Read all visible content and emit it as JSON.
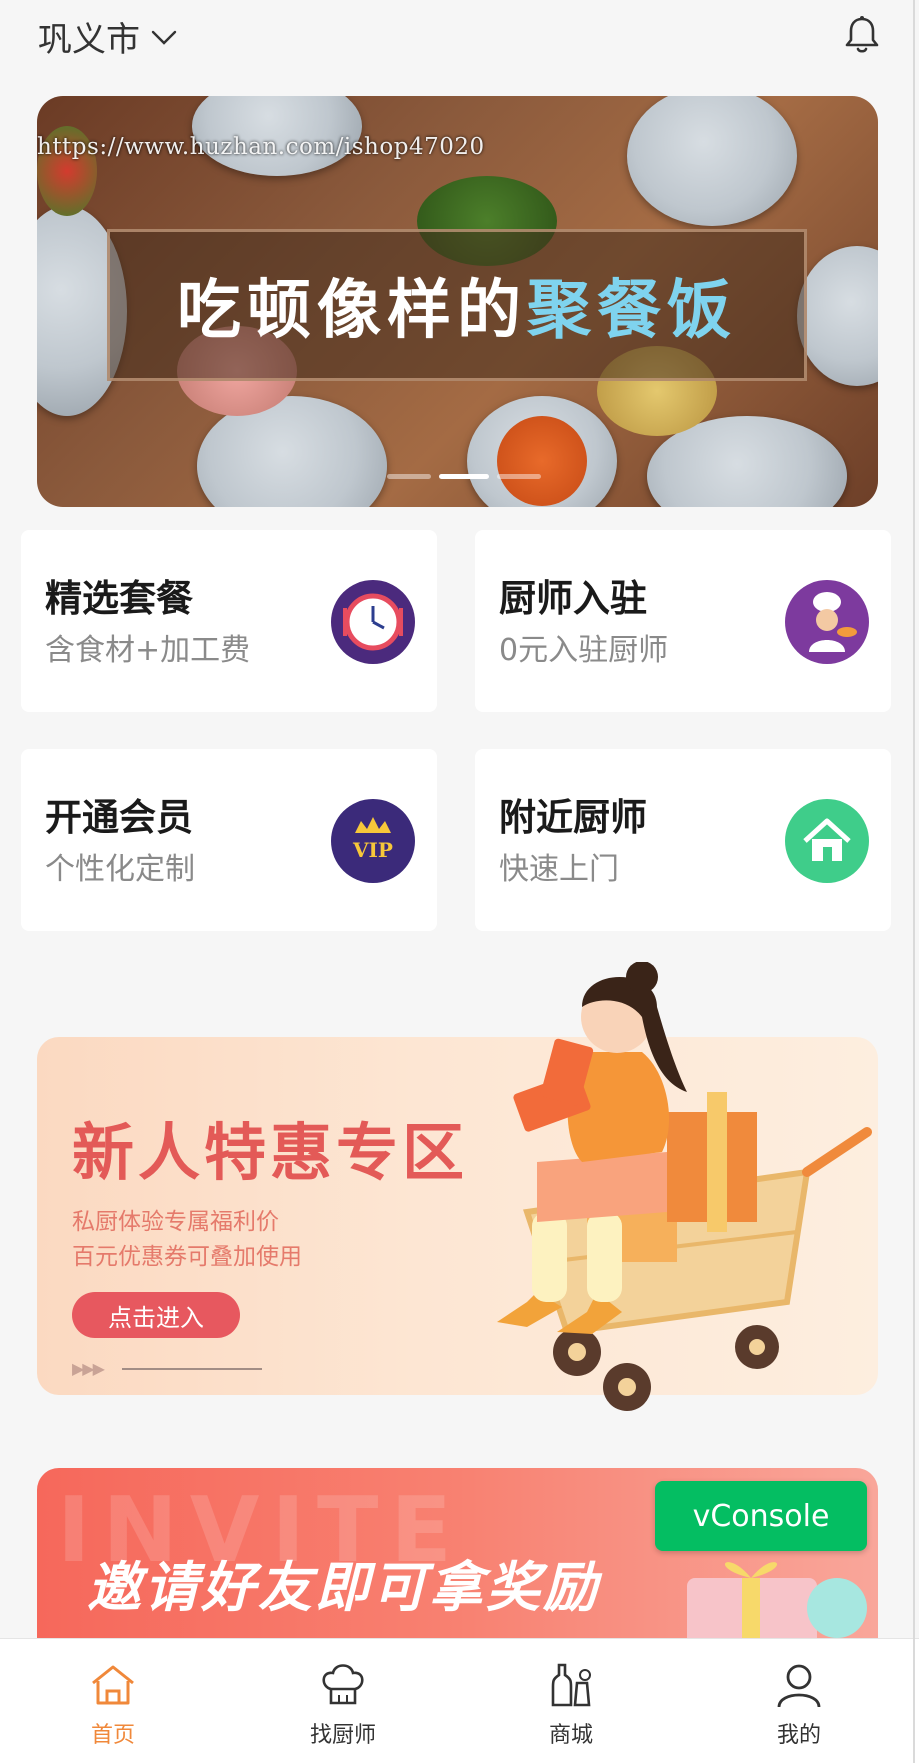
{
  "header": {
    "city": "巩义市",
    "chevron_icon": "chevron-down-icon",
    "bell_icon": "bell-icon"
  },
  "banner": {
    "watermark": "https://www.huzhan.com/ishop47020",
    "headline_main": "吃顿像样的",
    "headline_highlight": "聚餐饭",
    "highlight_color": "#7fd3ee",
    "slide_count": 3,
    "active_slide": 2
  },
  "cards": [
    {
      "title": "精选套餐",
      "subtitle": "含食材+加工费",
      "icon": "clock-cutlery-icon",
      "icon_color": "#4b2a7d"
    },
    {
      "title": "厨师入驻",
      "subtitle": "0元入驻厨师",
      "icon": "chef-icon",
      "icon_color": "#7d3a9e"
    },
    {
      "title": "开通会员",
      "subtitle": "个性化定制",
      "icon": "vip-crown-icon",
      "icon_color": "#3b2a7a"
    },
    {
      "title": "附近厨师",
      "subtitle": "快速上门",
      "icon": "home-icon",
      "icon_color": "#3fcd8a"
    }
  ],
  "promo": {
    "title": "新人特惠专区",
    "line1": "私厨体验专属福利价",
    "line2": "百元优惠券可叠加使用",
    "button": "点击进入",
    "accent": "#e35a57"
  },
  "invite": {
    "title": "邀请好友即可拿奖励",
    "bg_text": "INVITE"
  },
  "vconsole": {
    "label": "vConsole"
  },
  "tabbar": {
    "items": [
      {
        "label": "首页",
        "icon": "home-icon",
        "active": true
      },
      {
        "label": "找厨师",
        "icon": "chef-hat-icon",
        "active": false
      },
      {
        "label": "商城",
        "icon": "bottles-icon",
        "active": false
      },
      {
        "label": "我的",
        "icon": "user-icon",
        "active": false
      }
    ],
    "active_color": "#f0883a"
  }
}
